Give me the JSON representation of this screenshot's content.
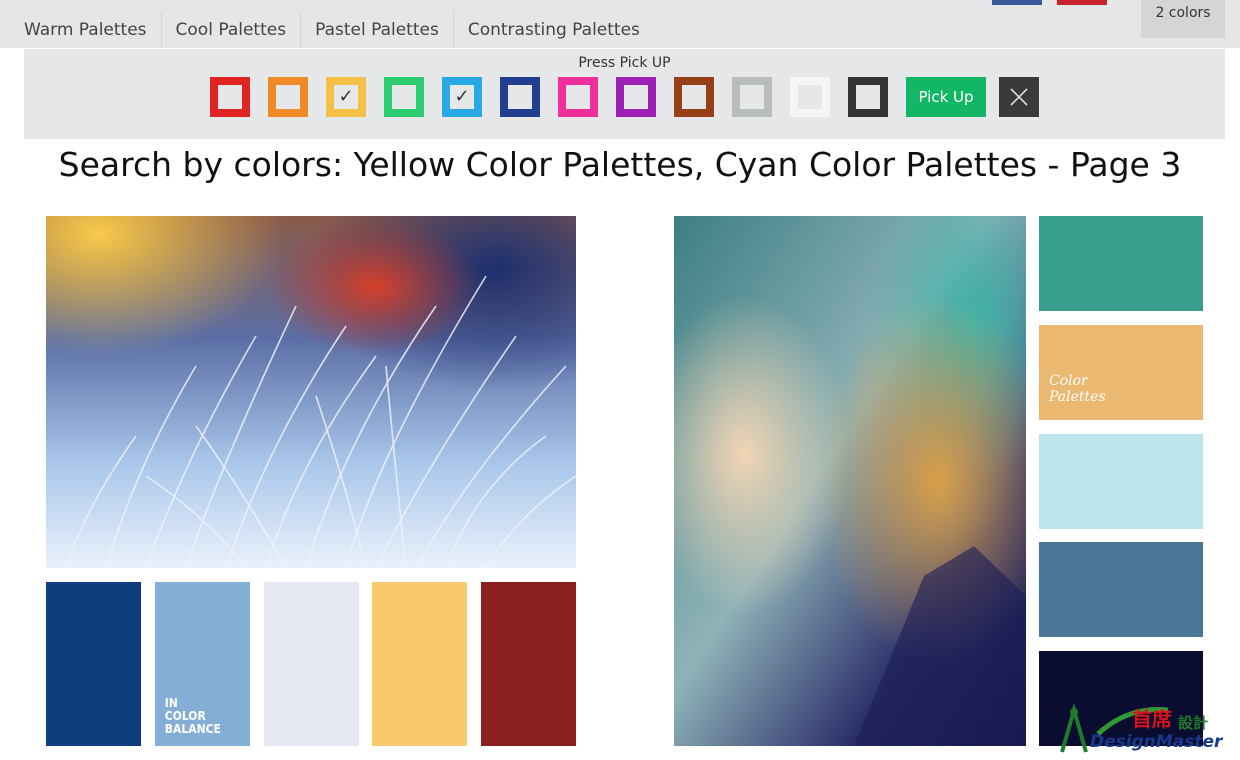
{
  "nav": {
    "tabs": [
      "Warm Palettes",
      "Cool Palettes",
      "Pastel Palettes",
      "Contrasting Palettes"
    ],
    "colors_count": "2 colors"
  },
  "picker": {
    "label": "Press Pick UP",
    "swatches": [
      {
        "color": "#e02323",
        "checked": false
      },
      {
        "color": "#ef8a26",
        "checked": false
      },
      {
        "color": "#f5c046",
        "checked": true
      },
      {
        "color": "#2ecc71",
        "checked": false
      },
      {
        "color": "#27aae1",
        "checked": true
      },
      {
        "color": "#213e8f",
        "checked": false
      },
      {
        "color": "#f02e9c",
        "checked": false
      },
      {
        "color": "#9e1fb8",
        "checked": false
      },
      {
        "color": "#963f19",
        "checked": false
      },
      {
        "color": "#b8bcbc",
        "checked": false
      },
      {
        "color": "#f5f5f5",
        "checked": false
      },
      {
        "color": "#333333",
        "checked": false
      }
    ],
    "pick_button": "Pick Up"
  },
  "heading": "Search by colors: Yellow Color Palettes, Cyan Color Palettes - Page 3",
  "palette1": {
    "chips": [
      "#103d7d",
      "#84aed5",
      "#e5e8f3",
      "#f8c96d",
      "#8b2020"
    ],
    "caption": [
      "IN",
      "COLOR",
      "BALANCE"
    ]
  },
  "palette2": {
    "chips": [
      "#3a9e8f",
      "#ebb871",
      "#bde4eb",
      "#4a7595",
      "#0b0d30"
    ],
    "caption": [
      "Color",
      "Palettes"
    ]
  },
  "logo": {
    "chinese": "首席設計",
    "text": "DesignMaster"
  }
}
